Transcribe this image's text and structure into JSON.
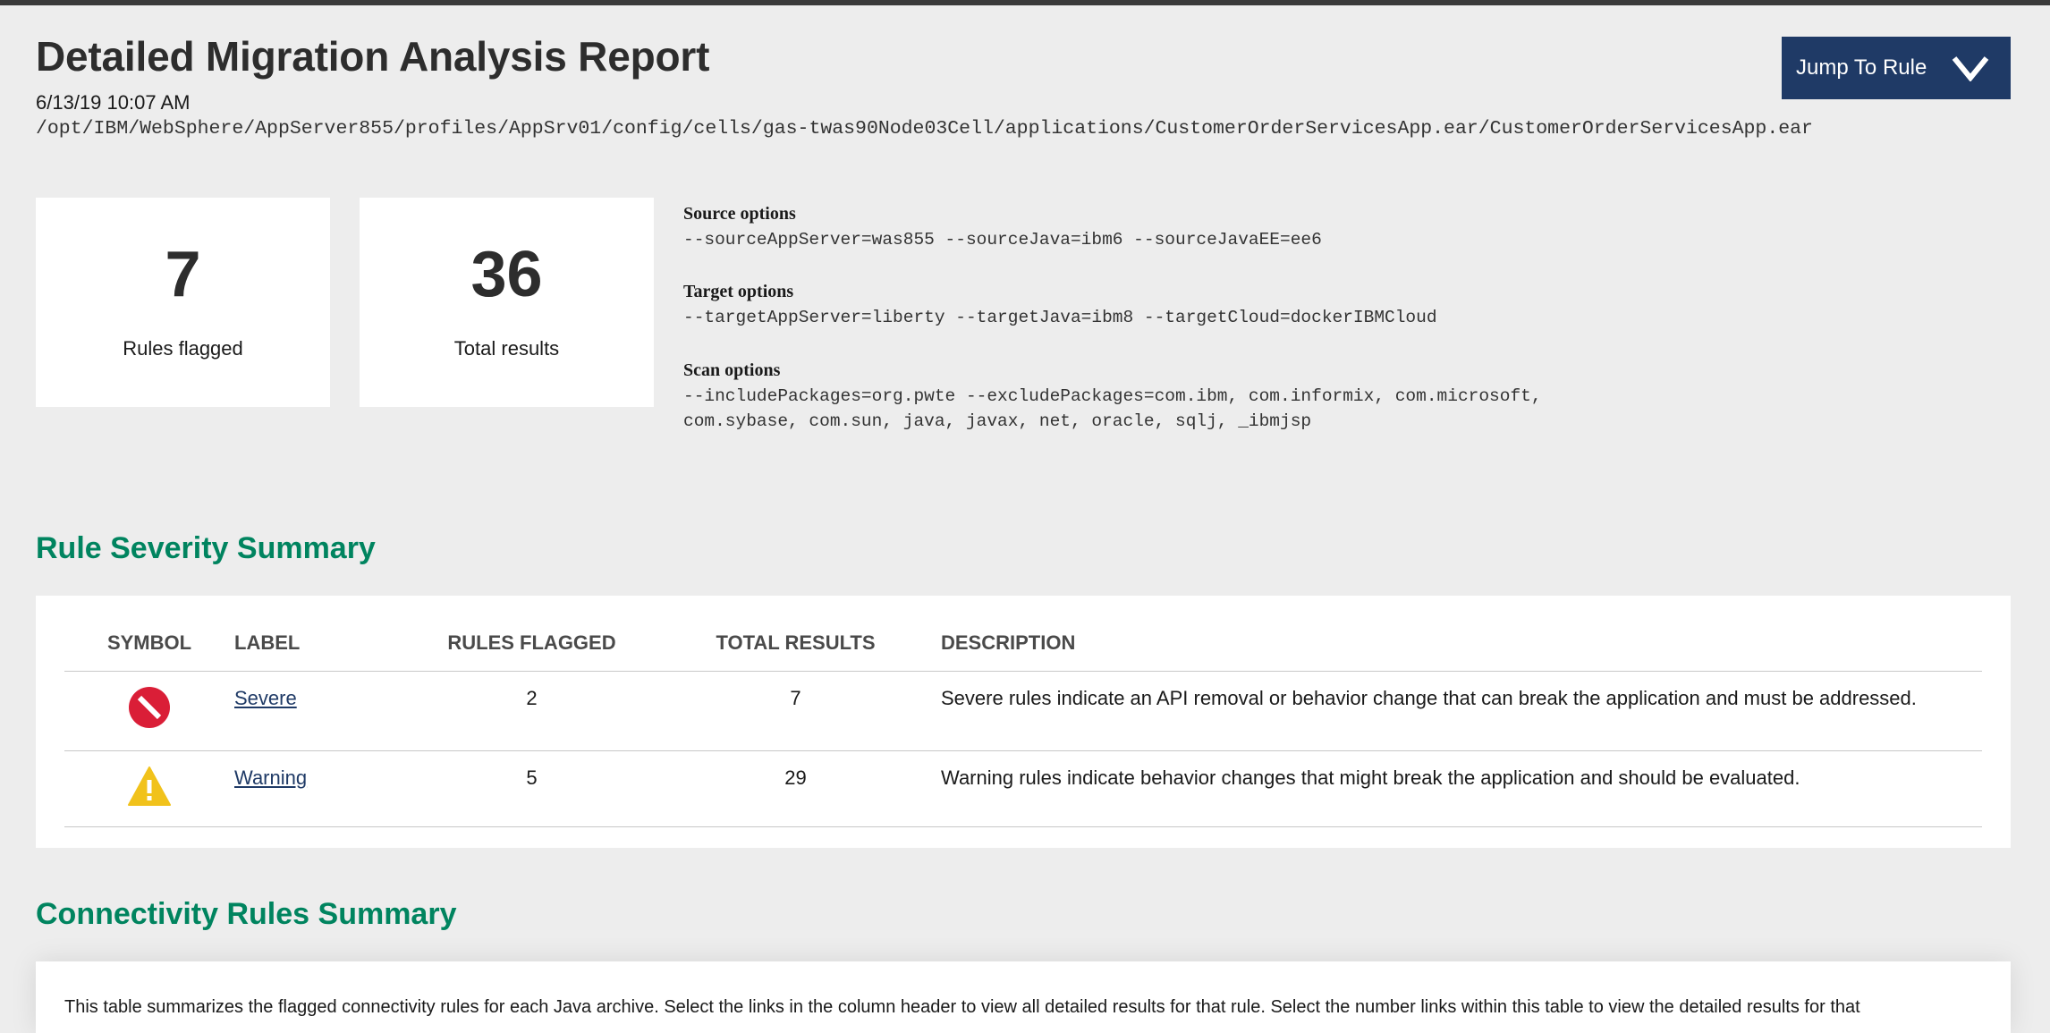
{
  "report": {
    "title": "Detailed Migration Analysis Report",
    "date": "6/13/19 10:07 AM",
    "path": "/opt/IBM/WebSphere/AppServer855/profiles/AppSrv01/config/cells/gas-twas90Node03Cell/applications/CustomerOrderServicesApp.ear/CustomerOrderServicesApp.ear"
  },
  "jump_button": {
    "label": "Jump To Rule",
    "icon": "chevron-down-icon"
  },
  "stats": {
    "rules_flagged": {
      "value": "7",
      "caption": "Rules flagged"
    },
    "total_results": {
      "value": "36",
      "caption": "Total results"
    }
  },
  "options": {
    "source": {
      "heading": "Source options",
      "value": "--sourceAppServer=was855 --sourceJava=ibm6 --sourceJavaEE=ee6"
    },
    "target": {
      "heading": "Target options",
      "value": "--targetAppServer=liberty --targetJava=ibm8 --targetCloud=dockerIBMCloud"
    },
    "scan": {
      "heading": "Scan options",
      "value_line1": "--includePackages=org.pwte --excludePackages=com.ibm, com.informix, com.microsoft,",
      "value_line2": "com.sybase, com.sun, java, javax, net, oracle, sqlj, _ibmjsp"
    }
  },
  "severity_summary": {
    "title": "Rule Severity Summary",
    "columns": [
      "SYMBOL",
      "LABEL",
      "RULES FLAGGED",
      "TOTAL RESULTS",
      "DESCRIPTION"
    ],
    "rows": [
      {
        "symbol": "severe-icon",
        "label": "Severe",
        "rules_flagged": "2",
        "total_results": "7",
        "description": "Severe rules indicate an API removal or behavior change that can break the application and must be addressed."
      },
      {
        "symbol": "warning-icon",
        "label": "Warning",
        "rules_flagged": "5",
        "total_results": "29",
        "description": "Warning rules indicate behavior changes that might break the application and should be evaluated."
      }
    ]
  },
  "connectivity_summary": {
    "title": "Connectivity Rules Summary",
    "intro": "This table summarizes the flagged connectivity rules for each Java archive. Select the links in the column header to view all detailed results for that rule. Select the number links within this table to view the detailed results for that"
  },
  "colors": {
    "background": "#ededed",
    "accent_green": "#00845f",
    "button_navy": "#1f3a66",
    "severe_red": "#da1e37",
    "warning_yellow": "#f1c21b"
  }
}
